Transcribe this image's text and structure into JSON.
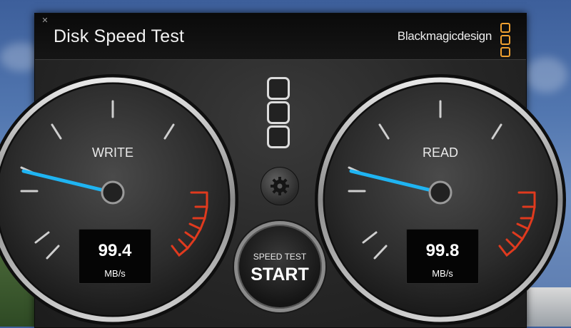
{
  "window": {
    "title": "Disk Speed Test",
    "brand": "Blackmagicdesign",
    "close_icon": "close-icon"
  },
  "write_gauge": {
    "label": "WRITE",
    "value": "99.4",
    "unit": "MB/s"
  },
  "read_gauge": {
    "label": "READ",
    "value": "99.8",
    "unit": "MB/s"
  },
  "controls": {
    "settings_icon": "gear-icon",
    "start_small": "SPEED TEST",
    "start_big": "START"
  },
  "colors": {
    "needle": "#1fb4f2",
    "redline": "#e03a1e",
    "brand_accent": "#f0a030"
  }
}
